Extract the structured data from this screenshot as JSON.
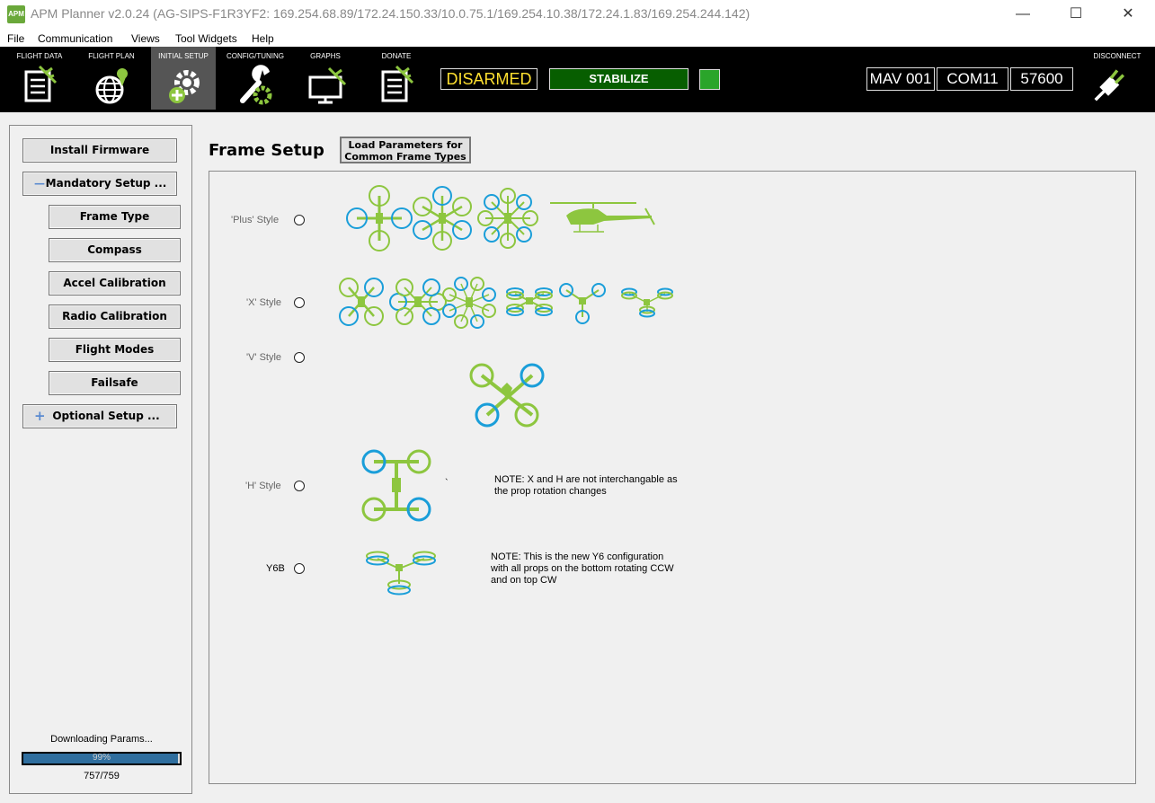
{
  "window": {
    "app_logo_text": "APM",
    "title": "APM Planner v2.0.24 (AG-SIPS-F1R3YF2: 169.254.68.89/172.24.150.33/10.0.75.1/169.254.10.38/172.24.1.83/169.254.244.142)"
  },
  "menu": [
    "File",
    "Communication",
    "Views",
    "Tool Widgets",
    "Help"
  ],
  "toolbar": {
    "buttons": [
      {
        "label": "FLIGHT DATA",
        "icon": "flight-data-icon"
      },
      {
        "label": "FLIGHT PLAN",
        "icon": "flight-plan-icon"
      },
      {
        "label": "INITIAL SETUP",
        "icon": "initial-setup-icon",
        "active": true
      },
      {
        "label": "CONFIG/TUNING",
        "icon": "config-tuning-icon"
      },
      {
        "label": "GRAPHS",
        "icon": "graphs-icon"
      },
      {
        "label": "DONATE",
        "icon": "donate-icon"
      }
    ],
    "arm_status": "DISARMED",
    "flight_mode": "STABILIZE",
    "mav": "MAV 001",
    "port": "COM11",
    "baud": "57600",
    "disconnect_label": "DISCONNECT"
  },
  "sidebar": {
    "install_firmware": "Install Firmware",
    "mandatory_setup": "Mandatory Setup ...",
    "mandatory_items": [
      "Frame Type",
      "Compass",
      "Accel Calibration",
      "Radio Calibration",
      "Flight Modes",
      "Failsafe"
    ],
    "optional_setup": "Optional Setup ...",
    "download_status": "Downloading Params...",
    "progress_text": "99%",
    "progress_fraction": 0.99,
    "param_count": "757/759"
  },
  "main": {
    "title": "Frame Setup",
    "load_button": [
      "Load Parameters for",
      "Common Frame Types"
    ],
    "rows": [
      {
        "label": "'Plus' Style"
      },
      {
        "label": "'X' Style"
      },
      {
        "label": "'V' Style"
      },
      {
        "label": "'H' Style"
      },
      {
        "label": "Y6B"
      }
    ],
    "note_xh": [
      "NOTE: X and H are not interchangable as",
      "the prop rotation changes"
    ],
    "note_y6b": [
      "NOTE: This is the new Y6 configuration",
      "with all props on the bottom rotating CCW",
      "and on top CW"
    ],
    "stray_mark": "`"
  },
  "colors": {
    "green": "#8dc63f",
    "blue": "#1a9ed9",
    "mode_bg": "#075e00",
    "arm_text": "#ffe030"
  }
}
